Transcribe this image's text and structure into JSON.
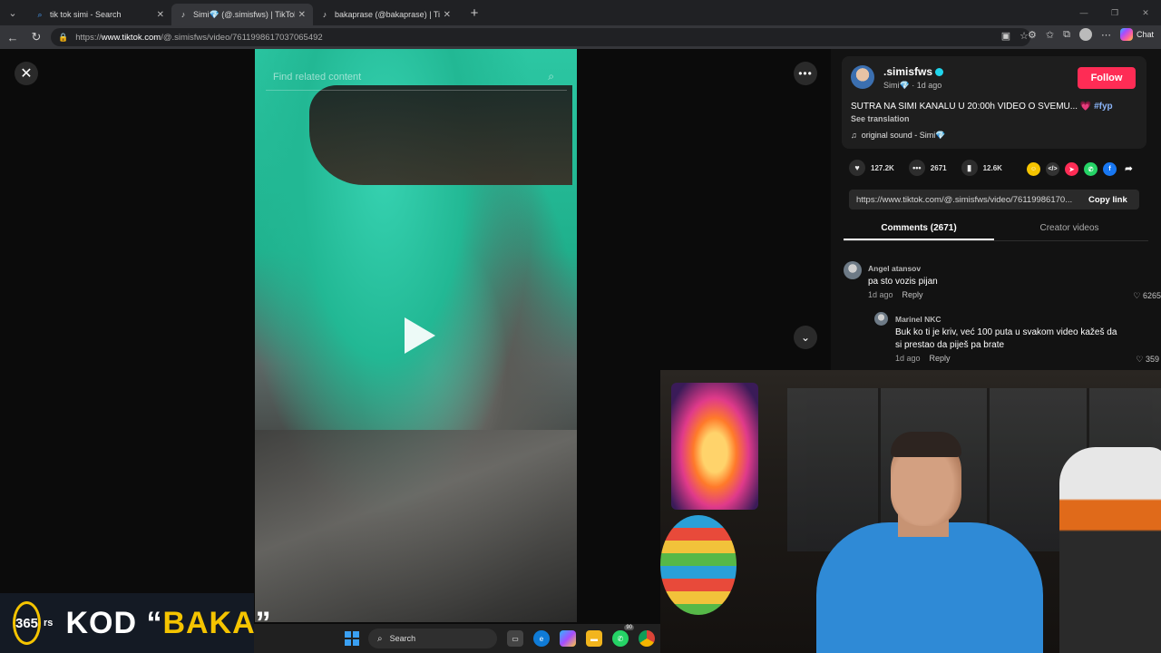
{
  "browser": {
    "tabs": [
      {
        "label": "tik tok simi - Search",
        "icon": "search-icon"
      },
      {
        "label": "Simi💎 (@.simisfws) | TikTok",
        "icon": "tiktok-icon"
      },
      {
        "label": "bakaprase (@bakaprase) | TikTok",
        "icon": "tiktok-icon"
      }
    ],
    "url_prefix": "https://",
    "url_domain": "www.tiktok.com",
    "url_path": "/@.simisfws/video/7611998617037065492",
    "chat_label": "Chat"
  },
  "video": {
    "search_placeholder": "Find related content"
  },
  "post": {
    "author": ".simisfws",
    "author_meta": "Simi💎 · 1d ago",
    "follow_label": "Follow",
    "description": "SUTRA NA SIMI KANALU U 20:00h VIDEO O SVEMU... 💗",
    "hashtag": "#fyp",
    "see_translation": "See translation",
    "sound": "original sound - Simi💎",
    "likes": "127.2K",
    "comments": "2671",
    "saves": "12.6K",
    "link": "https://www.tiktok.com/@.simisfws/video/76119986170...",
    "copy_link_label": "Copy link"
  },
  "panel_tabs": [
    {
      "label": "Comments (2671)",
      "active": true
    },
    {
      "label": "Creator videos",
      "active": false
    }
  ],
  "comments": [
    {
      "name": "Angel atansov",
      "text": "pa sto vozis pijan",
      "time": "1d ago",
      "reply": "Reply",
      "likes": "6265"
    },
    {
      "name": "Marinel NKC",
      "text": "Buk ko ti je kriv, već 100 puta u svakom video kažeš da si prestao da piješ pa brate",
      "time": "1d ago",
      "reply": "Reply",
      "likes": "359"
    }
  ],
  "brand": {
    "logo": "365",
    "logo_suffix": "rs",
    "text_prefix": "KOD “",
    "text_highlight": "BAKA",
    "text_suffix": "”"
  },
  "taskbar": {
    "search_label": "Search",
    "whatsapp_badge": "90"
  },
  "colors": {
    "follow": "#fe2c55",
    "accent_yellow": "#f5c400",
    "tiktok_cyan": "#20d5ec"
  }
}
